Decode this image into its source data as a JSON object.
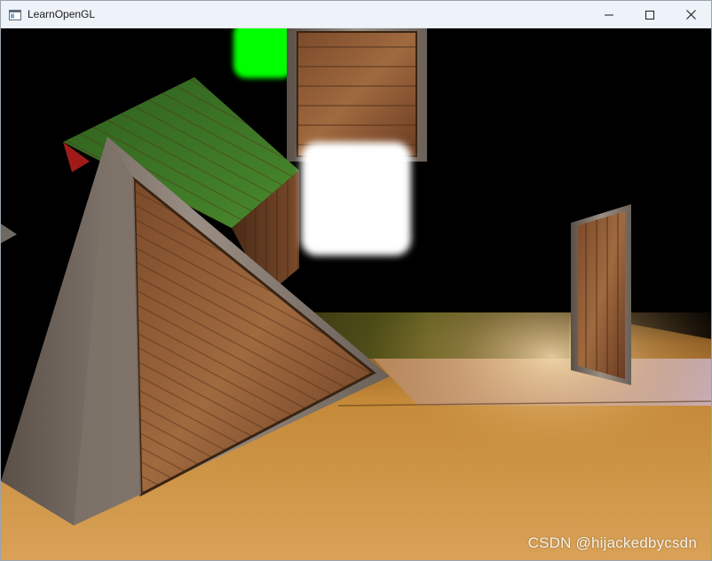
{
  "window": {
    "title": "LearnOpenGL",
    "app_icon": "window-app-icon",
    "caption_buttons": [
      {
        "name": "minimize-button",
        "icon": "minimize-icon"
      },
      {
        "name": "maximize-button",
        "icon": "maximize-icon"
      },
      {
        "name": "close-button",
        "icon": "close-icon"
      }
    ]
  },
  "scene": {
    "background_color": "#000000",
    "light_source_colors": [
      "#00ff00",
      "#ffffff"
    ],
    "floor_color": "#c88a3e",
    "watermark": "CSDN @hijackedbycsdn"
  }
}
